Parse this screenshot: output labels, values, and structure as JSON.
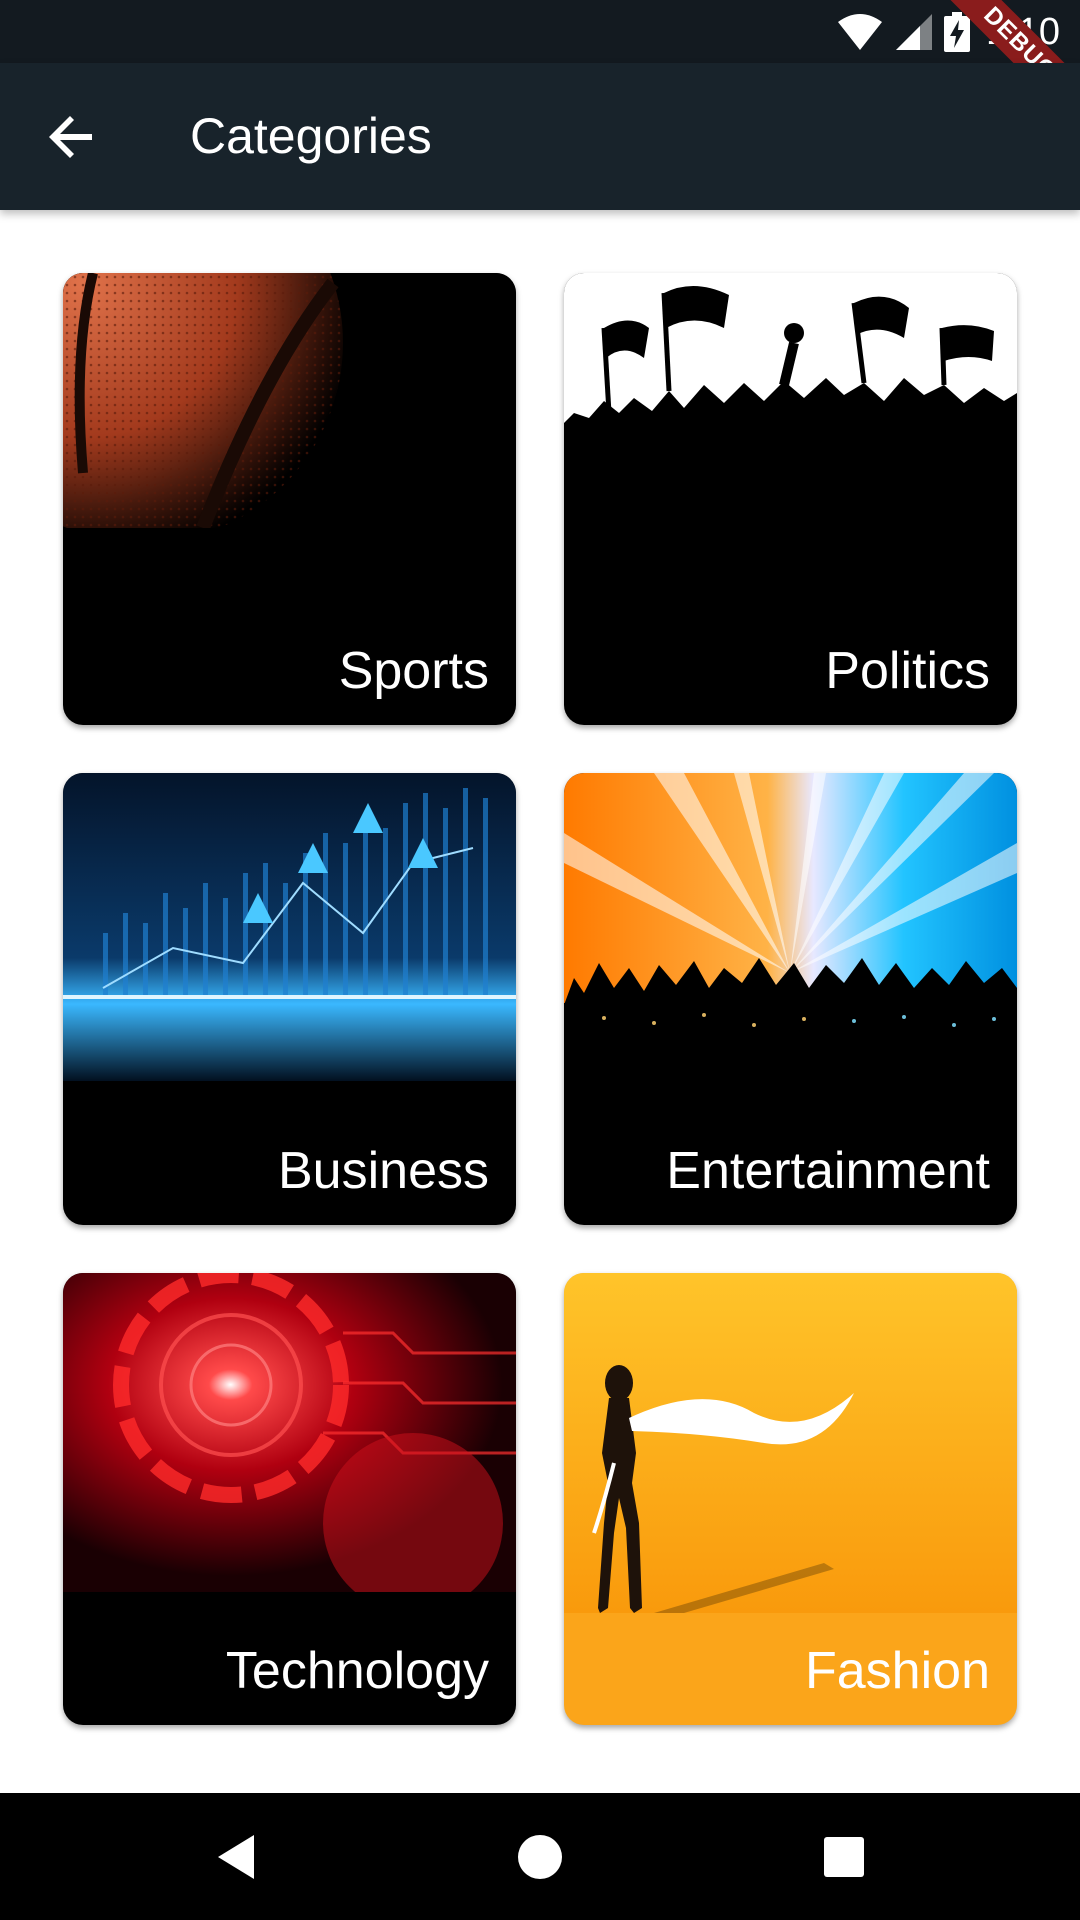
{
  "status_bar": {
    "time": "1:10",
    "icons": [
      "wifi-icon",
      "cell-signal-icon",
      "battery-charging-icon"
    ]
  },
  "debug_banner": "DEBUG",
  "app_bar": {
    "back_icon": "arrow-back-icon",
    "title": "Categories"
  },
  "categories": [
    {
      "label": "Sports"
    },
    {
      "label": "Politics"
    },
    {
      "label": "Business"
    },
    {
      "label": "Entertainment"
    },
    {
      "label": "Technology"
    },
    {
      "label": "Fashion"
    }
  ],
  "nav_bar": {
    "icons": [
      "back-triangle-icon",
      "home-circle-icon",
      "recents-square-icon"
    ]
  },
  "colors": {
    "status_bar": "#131a20",
    "app_bar": "#18232b",
    "card_dark": "#000000",
    "fashion_card": "#fba51a",
    "debug_ribbon": "#8a1c1c"
  }
}
